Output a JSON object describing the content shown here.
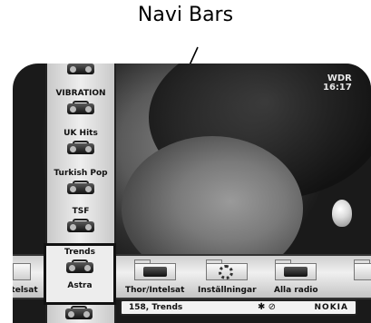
{
  "annotation": {
    "title": "Navi Bars"
  },
  "channel_logo": {
    "top": "WDR",
    "time": "16:17"
  },
  "sidebar": {
    "items": [
      {
        "label": "VIBRATION"
      },
      {
        "label": "UK Hits"
      },
      {
        "label": "Turkish Pop"
      },
      {
        "label": "TSF"
      },
      {
        "label": "Trends",
        "selected": true
      },
      {
        "label": "Astra",
        "selected": true
      }
    ]
  },
  "bottombar": {
    "items": [
      {
        "label": "ntelsat"
      },
      {
        "label": "Thor/Intelsat"
      },
      {
        "label": "Inställningar"
      },
      {
        "label": "Alla radio"
      }
    ]
  },
  "statusbar": {
    "channel": "158, Trends",
    "brand": "NOKIA"
  },
  "colors": {
    "bar_bg": "#e6e6e6",
    "border": "#222222",
    "text": "#111111"
  }
}
